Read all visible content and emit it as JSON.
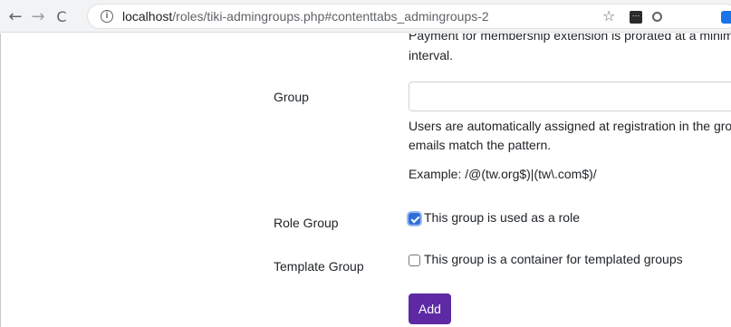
{
  "browser": {
    "url_host": "localhost",
    "url_path": "/roles/tiki-admingroups.php#contenttabs_admingroups-2"
  },
  "form": {
    "membership_help_line1": "Payment for membership extension is prorated at a minim",
    "membership_help_line2": "interval.",
    "group_label": "Group",
    "group_value": "",
    "group_help_line1": "Users are automatically assigned at registration in the gro",
    "group_help_line2": "emails match the pattern.",
    "group_example": "Example: /@(tw.org$)|(tw\\.com$)/",
    "role_group_label": "Role Group",
    "role_group_checkbox_label": "This group is used as a role",
    "role_group_checked": true,
    "template_group_label": "Template Group",
    "template_group_checkbox_label": "This group is a container for templated groups",
    "template_group_checked": false,
    "add_button_label": "Add"
  },
  "colors": {
    "accent_button": "#5d2aa3",
    "checkbox_checked": "#2f6fd8"
  }
}
